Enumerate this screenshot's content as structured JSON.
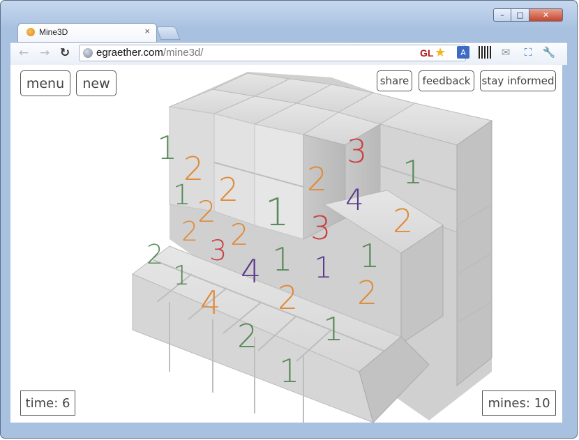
{
  "browser": {
    "tab_title": "Mine3D",
    "tab_close": "×",
    "url_host": "egraether.com",
    "url_path": "/mine3d/",
    "gl_badge": "GL",
    "window_buttons": {
      "minimize": "–",
      "maximize": "□",
      "close": "✕"
    },
    "nav": {
      "back": "←",
      "forward": "→",
      "reload": "↻"
    },
    "extension_icons": [
      "translate-icon",
      "qr-code-icon",
      "mail-icon",
      "fullscreen-icon",
      "wrench-icon"
    ]
  },
  "game": {
    "menu_label": "menu",
    "new_label": "new",
    "share_label": "share",
    "feedback_label": "feedback",
    "stay_informed_label": "stay informed",
    "time_label": "time: 6",
    "mines_label": "mines: 10",
    "colors": {
      "one": "#5a8a5a",
      "two": "#e08a3a",
      "three": "#c84040",
      "four": "#5a3a8a",
      "cube": "#d8d8d8"
    },
    "visible_numbers": [
      "1",
      "2",
      "1",
      "2",
      "2",
      "2",
      "2",
      "2",
      "3",
      "2",
      "1",
      "3",
      "1",
      "4",
      "1",
      "2",
      "3",
      "1",
      "1",
      "4",
      "1",
      "4",
      "2",
      "2",
      "2",
      "1",
      "1",
      "1"
    ]
  }
}
